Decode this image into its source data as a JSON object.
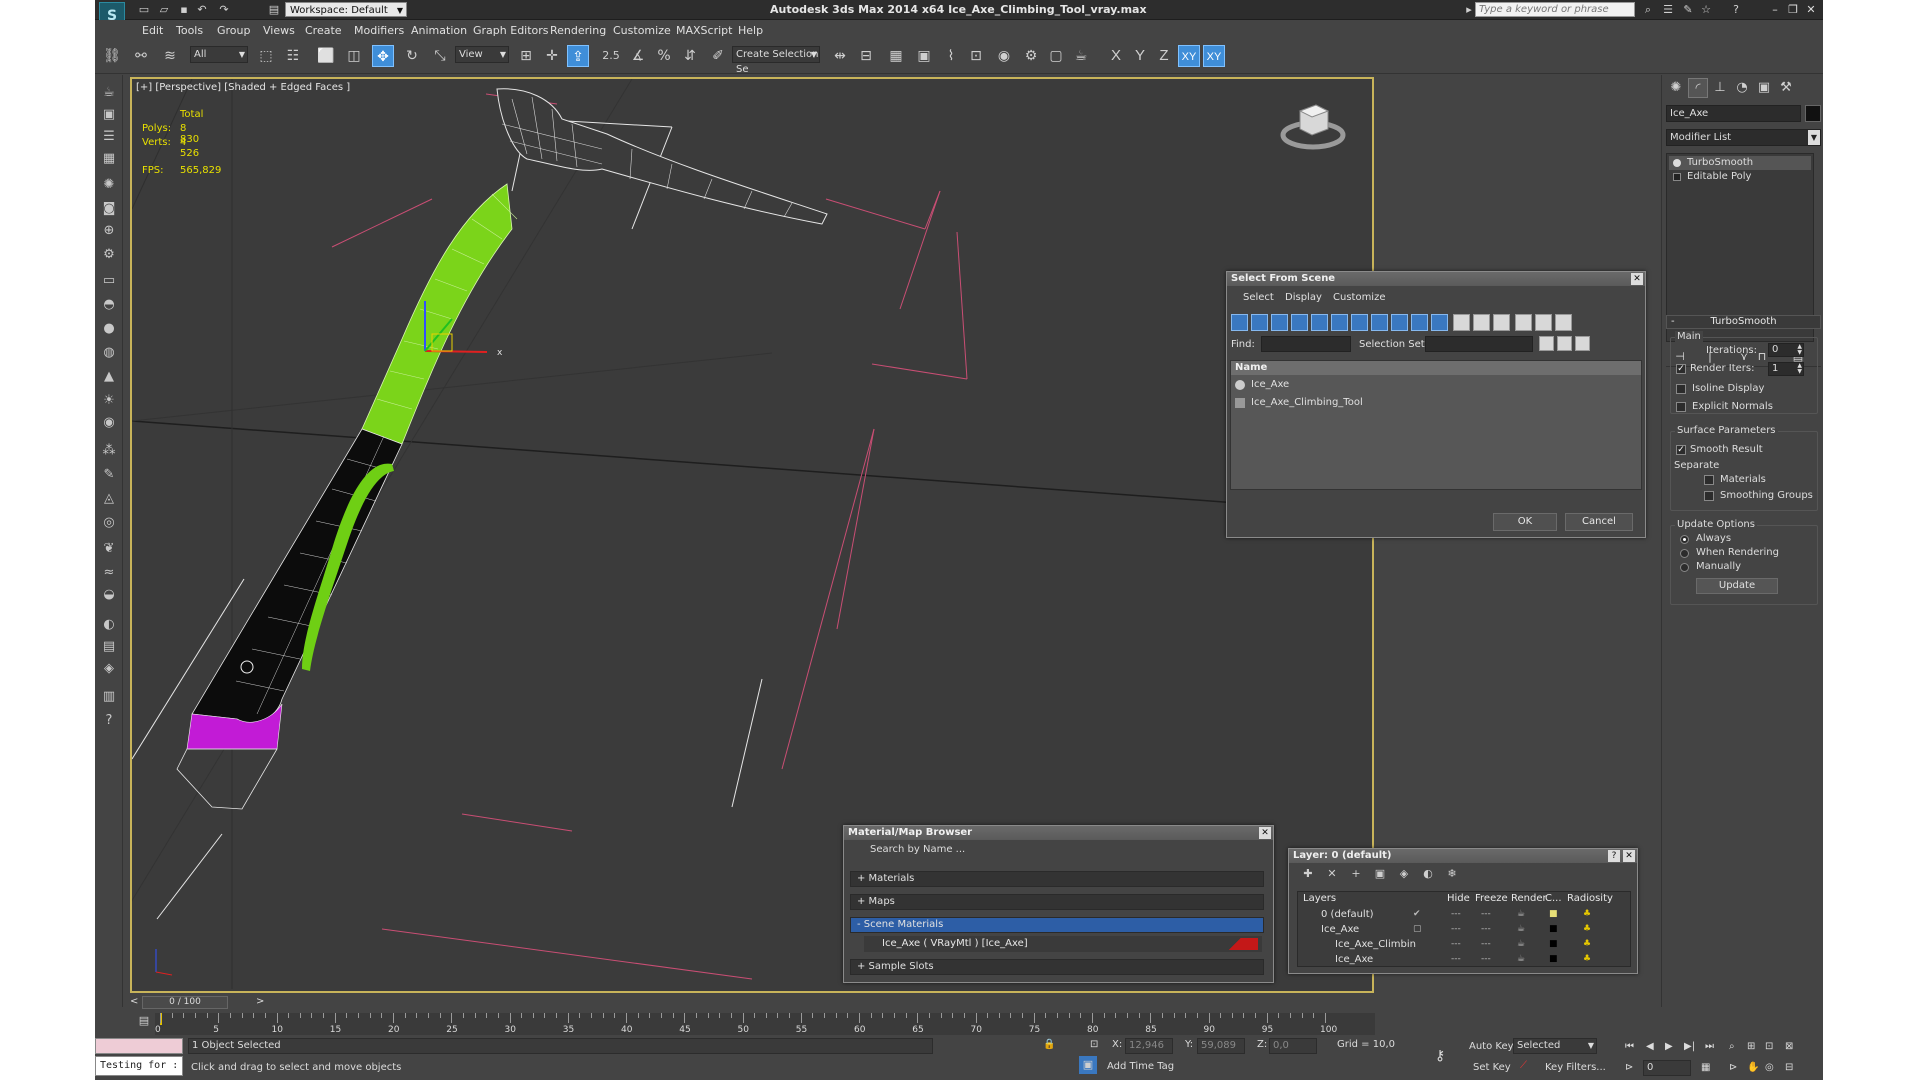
{
  "window": {
    "title": "Autodesk 3ds Max  2014 x64      Ice_Axe_Climbing_Tool_vray.max",
    "workspace": "Workspace: Default",
    "search_placeholder": "Type a keyword or phrase"
  },
  "menu": [
    "Edit",
    "Tools",
    "Group",
    "Views",
    "Create",
    "Modifiers",
    "Animation",
    "Graph Editors",
    "Rendering",
    "Customize",
    "MAXScript",
    "Help"
  ],
  "toolbar": {
    "selection_filter": "All",
    "ref_coord": "View",
    "named_selection_placeholder": "Create Selection Se",
    "axis_x": "X",
    "axis_y": "Y",
    "axis_z": "Z",
    "axis_xy": "XY",
    "axis_xy2": "XY",
    "snap_label": "2.5"
  },
  "viewport": {
    "label": "[+] [Perspective] [Shaded + Edged Faces ]",
    "stats": {
      "total_label": "Total",
      "polys_label": "Polys:",
      "polys": "8 830",
      "verts_label": "Verts:",
      "verts": "4 526",
      "fps_label": "FPS:",
      "fps": "565,829"
    },
    "gizmo_x": "x",
    "colors": {
      "grip": "#7bd41a",
      "pommel": "#c21bd6",
      "frame": "#c8b45a"
    }
  },
  "command_panel": {
    "object_name": "Ice_Axe",
    "modifier_list": "Modifier List",
    "stack": [
      "TurboSmooth",
      "Editable Poly"
    ],
    "rollout_title": "TurboSmooth",
    "main_label": "Main",
    "iterations_label": "Iterations:",
    "iterations": "0",
    "render_iters_label": "Render Iters:",
    "render_iters": "1",
    "isoline_label": "Isoline Display",
    "explicit_normals_label": "Explicit Normals",
    "surface_params_label": "Surface Parameters",
    "smooth_result_label": "Smooth Result",
    "separate_label": "Separate",
    "materials_label": "Materials",
    "smoothing_groups_label": "Smoothing Groups",
    "update_options_label": "Update Options",
    "always_label": "Always",
    "when_rendering_label": "When Rendering",
    "manually_label": "Manually",
    "update_button": "Update"
  },
  "select_from_scene": {
    "title": "Select From Scene",
    "menu": [
      "Select",
      "Display",
      "Customize"
    ],
    "find_label": "Find:",
    "selection_set_label": "Selection Set:",
    "column_name": "Name",
    "rows": [
      "Ice_Axe",
      "Ice_Axe_Climbing_Tool"
    ],
    "ok": "OK",
    "cancel": "Cancel"
  },
  "material_browser": {
    "title": "Material/Map Browser",
    "search_placeholder": "Search by Name ...",
    "sections": [
      "+ Materials",
      "+ Maps",
      "- Scene Materials"
    ],
    "scene_material": "Ice_Axe  ( VRayMtl ) [Ice_Axe]",
    "sample_slots": "+ Sample Slots"
  },
  "layer_dialog": {
    "title": "Layer: 0 (default)",
    "columns": [
      "Layers",
      "Hide",
      "Freeze",
      "Render",
      "C...",
      "Radiosity"
    ],
    "rows": [
      {
        "name": "0 (default)",
        "indent": 0
      },
      {
        "name": "Ice_Axe",
        "indent": 0
      },
      {
        "name": "Ice_Axe_Climbin",
        "indent": 1
      },
      {
        "name": "Ice_Axe",
        "indent": 1
      }
    ]
  },
  "timeline": {
    "frame": "0 / 100",
    "ticks": [
      "0",
      "5",
      "10",
      "15",
      "20",
      "25",
      "30",
      "35",
      "40",
      "45",
      "50",
      "55",
      "60",
      "65",
      "70",
      "75",
      "80",
      "85",
      "90",
      "95",
      "100"
    ]
  },
  "status": {
    "script_text": "Testing for :",
    "selected": "1 Object Selected",
    "prompt": "Click and drag to select and move objects",
    "x_label": "X:",
    "x": "12,946",
    "y_label": "Y:",
    "y": "59,089",
    "z_label": "Z:",
    "z": "0,0",
    "grid": "Grid = 10,0",
    "add_time_tag": "Add Time Tag",
    "auto_key": "Auto Key",
    "set_key": "Set Key",
    "selected_dd": "Selected",
    "key_filters": "Key Filters...",
    "frame_field": "0"
  }
}
